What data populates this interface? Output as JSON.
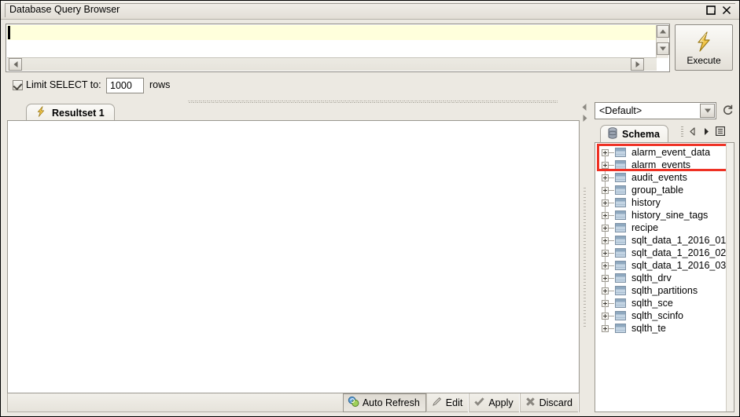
{
  "window": {
    "title": "Database Query Browser",
    "controls": [
      {
        "name": "restore-button",
        "icon": "restore-icon",
        "label": "Restore"
      },
      {
        "name": "close-button",
        "icon": "close-icon",
        "label": "Close"
      }
    ]
  },
  "query_editor": {
    "text": "",
    "placeholder": "",
    "current_line_highlight_color": "#ffffdc",
    "caret_visible": true,
    "vertical_scrollbar": {
      "up_label": "Scroll up",
      "down_label": "Scroll down"
    },
    "horizontal_scrollbar": {
      "left_label": "Scroll left",
      "right_label": "Scroll right"
    }
  },
  "execute": {
    "label": "Execute",
    "icon": "lightning-bolt-icon"
  },
  "limit": {
    "checkbox_checked": true,
    "label": "Limit SELECT to:",
    "value": "1000",
    "placeholder": "1000",
    "suffix": "rows"
  },
  "result_tabs": [
    {
      "label": "Resultset 1",
      "icon": "lightning-bolt-icon",
      "active": true
    }
  ],
  "result_grid": {
    "rows": [],
    "columns": []
  },
  "bottom_toolbar": {
    "buttons": [
      {
        "label": "Auto Refresh",
        "icon": "auto-refresh-icon",
        "pressed": true
      },
      {
        "label": "Edit",
        "icon": "pencil-icon",
        "pressed": false
      },
      {
        "label": "Apply",
        "icon": "check-icon",
        "pressed": false
      },
      {
        "label": "Discard",
        "icon": "cross-icon",
        "pressed": false
      }
    ]
  },
  "sidebar": {
    "schema_selector": {
      "value": "<Default>",
      "options": [
        "<Default>"
      ]
    },
    "refresh_icon": "refresh-icon",
    "tabs": [
      {
        "label": "Schema",
        "icon": "database-icon",
        "active": true
      }
    ],
    "tab_tools": [
      {
        "name": "prev-icon",
        "label": "Previous"
      },
      {
        "name": "next-icon",
        "label": "Next"
      },
      {
        "name": "list-menu-icon",
        "label": "Menu"
      }
    ],
    "tree": {
      "highlight_color": "#ee3124",
      "highlighted_count": 2,
      "items": [
        {
          "label": "alarm_event_data",
          "icon": "table-icon",
          "expanded": false,
          "highlighted": true
        },
        {
          "label": "alarm_events",
          "icon": "table-icon",
          "expanded": false,
          "highlighted": true
        },
        {
          "label": "audit_events",
          "icon": "table-icon",
          "expanded": false,
          "highlighted": false
        },
        {
          "label": "group_table",
          "icon": "table-icon",
          "expanded": false,
          "highlighted": false
        },
        {
          "label": "history",
          "icon": "table-icon",
          "expanded": false,
          "highlighted": false
        },
        {
          "label": "history_sine_tags",
          "icon": "table-icon",
          "expanded": false,
          "highlighted": false
        },
        {
          "label": "recipe",
          "icon": "table-icon",
          "expanded": false,
          "highlighted": false
        },
        {
          "label": "sqlt_data_1_2016_01",
          "icon": "table-icon",
          "expanded": false,
          "highlighted": false
        },
        {
          "label": "sqlt_data_1_2016_02",
          "icon": "table-icon",
          "expanded": false,
          "highlighted": false
        },
        {
          "label": "sqlt_data_1_2016_03",
          "icon": "table-icon",
          "expanded": false,
          "highlighted": false
        },
        {
          "label": "sqlth_drv",
          "icon": "table-icon",
          "expanded": false,
          "highlighted": false
        },
        {
          "label": "sqlth_partitions",
          "icon": "table-icon",
          "expanded": false,
          "highlighted": false
        },
        {
          "label": "sqlth_sce",
          "icon": "table-icon",
          "expanded": false,
          "highlighted": false
        },
        {
          "label": "sqlth_scinfo",
          "icon": "table-icon",
          "expanded": false,
          "highlighted": false
        },
        {
          "label": "sqlth_te",
          "icon": "table-icon",
          "expanded": false,
          "highlighted": false
        }
      ]
    }
  },
  "splitter": {
    "collapse_left_label": "Collapse left",
    "collapse_right_label": "Collapse right"
  }
}
